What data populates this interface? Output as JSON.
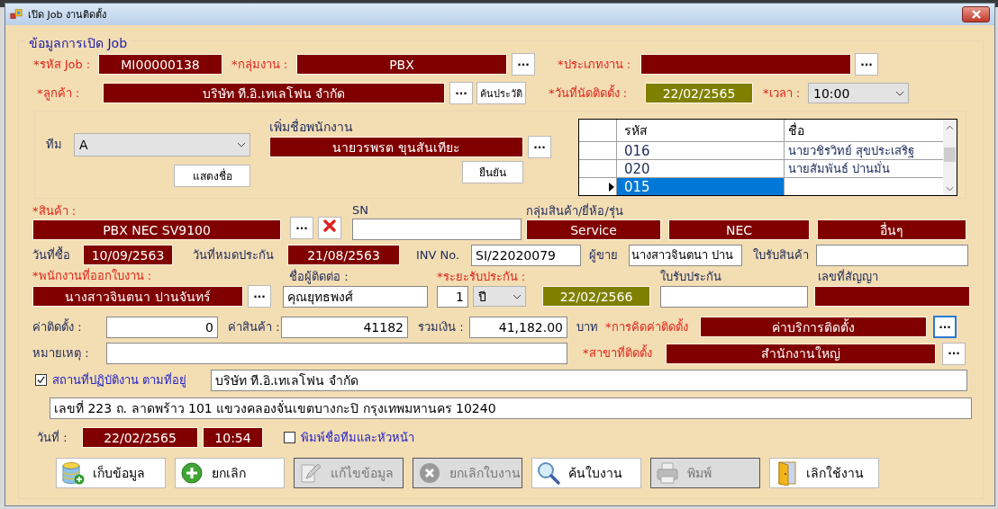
{
  "window": {
    "title": "เปิด Job งานติดตั้ง"
  },
  "group_title": "ข้อมูลการเปิด Job",
  "job": {
    "label": "*รหัส Job :",
    "value": "MI00000138"
  },
  "work_group": {
    "label": "*กลุ่มงาน :",
    "value": "PBX",
    "button": "..."
  },
  "work_type": {
    "label": "*ประเภทงาน :",
    "button": "..."
  },
  "customer": {
    "label": "*ลูกค้า :",
    "value": "บริษัท ที.อิ.เทเลโฟน จำกัด",
    "button": "...",
    "history_button": "ค้นประวัติ"
  },
  "appointment": {
    "label": "*วันที่นัดติดตั้ง :",
    "date": "22/02/2565",
    "time_label": "*เวลา :",
    "time": "10:00"
  },
  "team": {
    "label": "ทีม",
    "value": "A",
    "show_button": "แสดงชื่อ"
  },
  "add_employee": {
    "label": "เพิ่มชื่อพนักงาน",
    "value": "นายวรพรต ขุนสันเทียะ",
    "button": "...",
    "confirm_button": "ยืนยัน"
  },
  "staff_table": {
    "columns": [
      "รหัส",
      "ชื่อ"
    ],
    "rows": [
      {
        "code": "016",
        "name": "นายวชิรวิทย์ สุขประเสริฐ",
        "selected": false
      },
      {
        "code": "020",
        "name": "นายสัมพันธ์  ปานมั่น",
        "selected": false
      },
      {
        "code": "015",
        "selected": true
      }
    ]
  },
  "product": {
    "label": "*สินค้า :",
    "value": "PBX NEC SV9100",
    "button": "..."
  },
  "serial": {
    "label": "SN"
  },
  "product_group": {
    "label": "กลุ่มสินค้า/ยี่ห้อ/รุ่น",
    "values": [
      "Service",
      "NEC",
      "อื่นๆ"
    ]
  },
  "purchase_date": {
    "label": "วันที่ซื้อ",
    "value": "10/09/2563"
  },
  "warranty_end": {
    "label": "วันที่หมดประกัน",
    "value": "21/08/2563"
  },
  "invoice": {
    "label": "INV No.",
    "value": "SI/22020079"
  },
  "seller": {
    "label": "ผู้ขาย",
    "value": "นางสาวจินตนา ปาน"
  },
  "receipt": {
    "label": "ใบรับสินค้า"
  },
  "issuer": {
    "label": "*พนักงานที่ออกใบงาน :",
    "value": "นางสาวจินตนา ปานจันทร์",
    "button": "..."
  },
  "contact": {
    "label": "ชื่อผู้ติดต่อ :",
    "value": "คุณยุทธพงศ์"
  },
  "warranty": {
    "label": "*ระยะรับประกัน :",
    "amount": "1",
    "unit": "ปี",
    "until": "22/02/2566"
  },
  "warranty_receipt": {
    "label": "ใบรับประกัน"
  },
  "contract": {
    "label": "เลขที่สัญญา"
  },
  "install_fee": {
    "label": "ค่าติดตั้ง :",
    "value": "0"
  },
  "product_price": {
    "label": "ค่าสินค้า :",
    "value": "41182"
  },
  "total": {
    "label": "รวมเงิน :",
    "value": "41,182.00",
    "unit": "บาท"
  },
  "fee_method": {
    "label": "*การคิดค่าติดตั้ง",
    "value": "ค่าบริการติดตั้ง",
    "button": "..."
  },
  "note": {
    "label": "หมายเหตุ :"
  },
  "branch": {
    "label": "*สาขาที่ติดตั้ง",
    "value": "สำนักงานใหญ่",
    "button": "..."
  },
  "site": {
    "label": "สถานที่ปฏิบัติงาน ตามที่อยู่",
    "checked": true,
    "name": "บริษัท ที.อิ.เทเลโฟน จำกัด",
    "address": "เลขที่  223  ถ. ลาดพร้าว 101  แขวงคลองจั่นเขตบางกะปิ  กรุงเทพมหานคร  10240"
  },
  "record_date": {
    "label": "วันที่ :",
    "date": "22/02/2565",
    "time": "10:54"
  },
  "print_team": {
    "label": "พิมพ์ชื่อทีมและหัวหน้า",
    "checked": false
  },
  "buttons": [
    {
      "label": "เก็บข้อมูล",
      "kind": "save",
      "disabled": false
    },
    {
      "label": "ยกเลิก",
      "kind": "new",
      "disabled": false
    },
    {
      "label": "แก้ไขข้อมูล",
      "kind": "edit",
      "disabled": true
    },
    {
      "label": "ยกเลิกใบงาน",
      "kind": "cancel",
      "disabled": true
    },
    {
      "label": "ค้นใบงาน",
      "kind": "search",
      "disabled": false
    },
    {
      "label": "พิมพ์",
      "kind": "print",
      "disabled": true
    },
    {
      "label": "เลิกใช้งาน",
      "kind": "exit",
      "disabled": false
    }
  ]
}
